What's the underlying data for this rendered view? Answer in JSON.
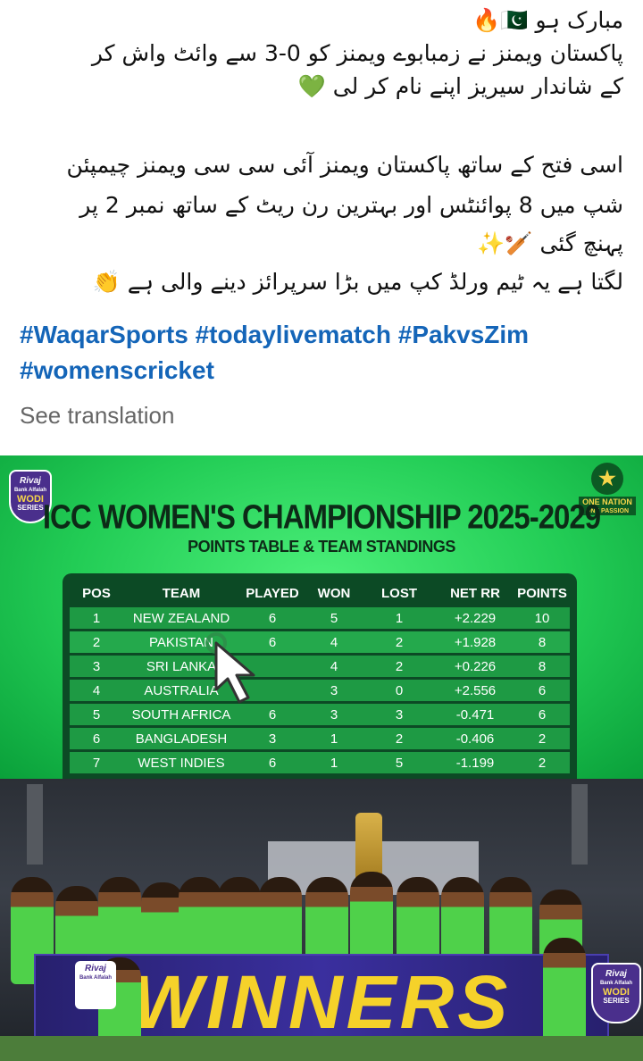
{
  "post": {
    "urdu_lines": [
      "مبارک ہو 🇵🇰🔥",
      "پاکستان ویمنز نے زمبابوے ویمنز کو 0-3 سے وائٹ واش کر",
      "کے شاندار سیریز اپنے نام کر لی 💚",
      "اسی فتح کے ساتھ پاکستان ویمنز آئی سی سی ویمنز چیمپئن",
      "شپ میں 8 پوائنٹس اور بہترین رن ریٹ کے ساتھ نمبر 2 پر",
      "پہنچ گئی 🏏✨",
      "لگتا ہے یہ ٹیم ورلڈ کپ میں بڑا سرپرائز دینے والی ہے 👏"
    ],
    "hashtags": [
      "#WaqarSports",
      "#todaylivematch",
      "#PakvsZim",
      "#womenscricket"
    ],
    "see_translation": "See translation"
  },
  "standings_image": {
    "title": "ICC WOMEN'S CHAMPIONSHIP 2025-2029",
    "subtitle": "POINTS TABLE & TEAM STANDINGS",
    "logo_left_lines": [
      "Rivaj",
      "Bank Alfalah",
      "WODI",
      "SERIES"
    ],
    "logo_right_lines": [
      "ONE NATION",
      "ONE PASSION"
    ],
    "columns": [
      "POS",
      "TEAM",
      "PLAYED",
      "WON",
      "LOST",
      "NET RR",
      "POINTS"
    ],
    "rows": [
      [
        "1",
        "NEW ZEALAND",
        "6",
        "5",
        "1",
        "+2.229",
        "10"
      ],
      [
        "2",
        "PAKISTAN",
        "6",
        "4",
        "2",
        "+1.928",
        "8"
      ],
      [
        "3",
        "SRI LANKA",
        "",
        "4",
        "2",
        "+0.226",
        "8"
      ],
      [
        "4",
        "AUSTRALIA",
        "",
        "3",
        "0",
        "+2.556",
        "6"
      ],
      [
        "5",
        "SOUTH AFRICA",
        "6",
        "3",
        "3",
        "-0.471",
        "6"
      ],
      [
        "6",
        "BANGLADESH",
        "3",
        "1",
        "2",
        "-0.406",
        "2"
      ],
      [
        "7",
        "WEST INDIES",
        "6",
        "1",
        "5",
        "-1.199",
        "2"
      ]
    ]
  },
  "photo": {
    "banner_text": "WINNERS",
    "badge_left_lines": [
      "Rivaj",
      "Bank Alfalah"
    ],
    "badge_right_lines": [
      "Rivaj",
      "Bank Alfalah",
      "WODI",
      "SERIES"
    ]
  }
}
